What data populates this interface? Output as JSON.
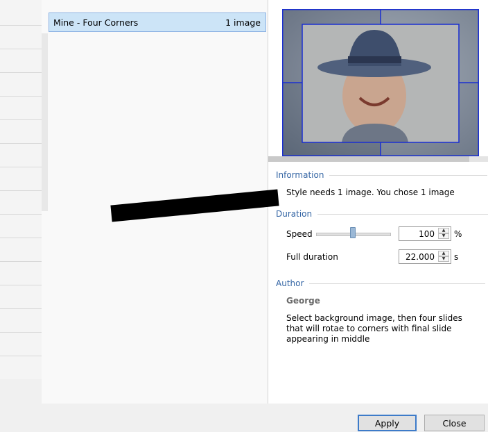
{
  "style_list": {
    "item_name": "Mine - Four Corners",
    "item_count": "1 image"
  },
  "information": {
    "header": "Information",
    "text": "Style needs 1 image. You chose 1 image"
  },
  "duration": {
    "header": "Duration",
    "speed_label": "Speed",
    "speed_value": "100",
    "speed_unit": "%",
    "full_duration_label": "Full duration",
    "full_duration_value": "22.000",
    "full_duration_unit": "s"
  },
  "author": {
    "header": "Author",
    "name": "George",
    "description": "Select background image, then four slides that will rotae to corners with final slide appearing in middle"
  },
  "buttons": {
    "apply": "Apply",
    "close": "Close"
  },
  "window": {
    "close_glyph": "✕"
  },
  "colors": {
    "selection": "#cce4f7",
    "section_header": "#3465a4",
    "preview_frame": "#1a2fd1"
  },
  "icons": [
    "close-icon",
    "spin-up-icon",
    "spin-down-icon",
    "slider-thumb"
  ]
}
